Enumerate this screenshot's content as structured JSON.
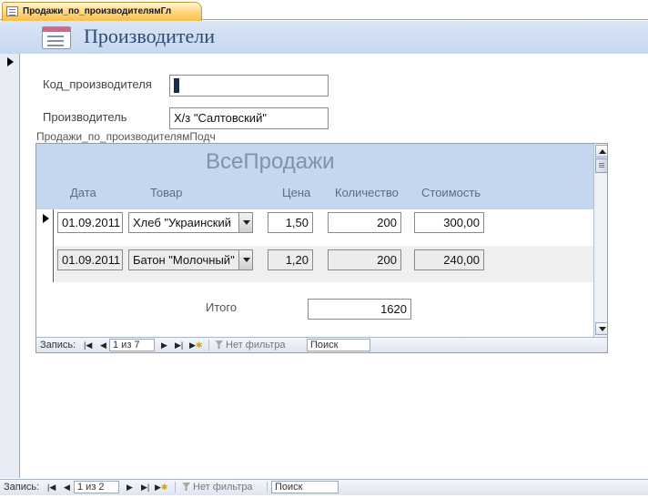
{
  "tab": {
    "title": "Продажи_по_производителямГл"
  },
  "header": {
    "title": "Производители"
  },
  "fields": {
    "code_label": "Код_производителя",
    "code_value": "1",
    "producer_label": "Производитель",
    "producer_value": "Х/з \"Салтовский\""
  },
  "subform": {
    "label": "Продажи_по_производителямПодч",
    "title": "ВсеПродажи",
    "columns": [
      "Дата",
      "Товар",
      "Цена",
      "Количество",
      "Стоимость"
    ],
    "rows": [
      {
        "date": "01.09.2011",
        "product": "Хлеб \"Украинский",
        "price": "1,50",
        "qty": "200",
        "cost": "300,00"
      },
      {
        "date": "01.09.2011",
        "product": "Батон \"Молочный\"",
        "price": "1,20",
        "qty": "200",
        "cost": "240,00"
      }
    ],
    "total_label": "Итого",
    "total_value": "1620",
    "nav": {
      "record_label": "Запись:",
      "position": "1 из 7",
      "filter": "Нет фильтра",
      "search": "Поиск"
    }
  },
  "main_nav": {
    "record_label": "Запись:",
    "position": "1 из 2",
    "filter": "Нет фильтра",
    "search": "Поиск"
  },
  "icons": {
    "tab": "form-icon",
    "header": "form-icon",
    "first": "first-record-icon",
    "prev": "prev-record-icon",
    "next": "next-record-icon",
    "last": "last-record-icon",
    "new": "new-record-icon",
    "filter": "filter-icon"
  }
}
